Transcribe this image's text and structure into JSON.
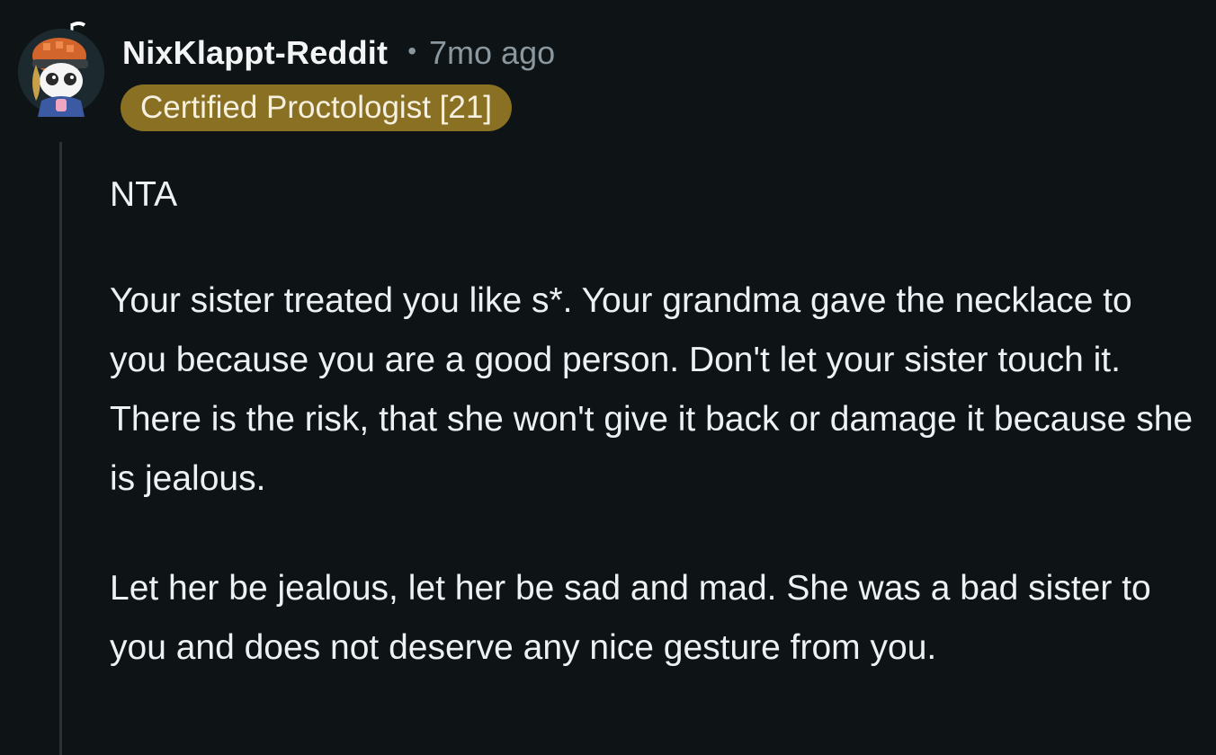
{
  "comment": {
    "author": "NixKlappt-Reddit",
    "separator": "•",
    "time_ago": "7mo ago",
    "flair": "Certified Proctologist [21]",
    "paragraphs": [
      "NTA",
      "Your sister treated you like s*. Your grandma gave the necklace to you because you are a good person. Don't let your sister touch it. There is the risk, that she won't give it back or damage it because she is jealous.",
      "Let her be jealous, let her be sad and mad. She was a bad sister to you and does not deserve any nice gesture from you."
    ]
  },
  "colors": {
    "background": "#0e1416",
    "flair_background": "#8a7023",
    "muted_text": "#8a979e"
  },
  "icons": {
    "avatar": "snoo-avatar-icon"
  }
}
